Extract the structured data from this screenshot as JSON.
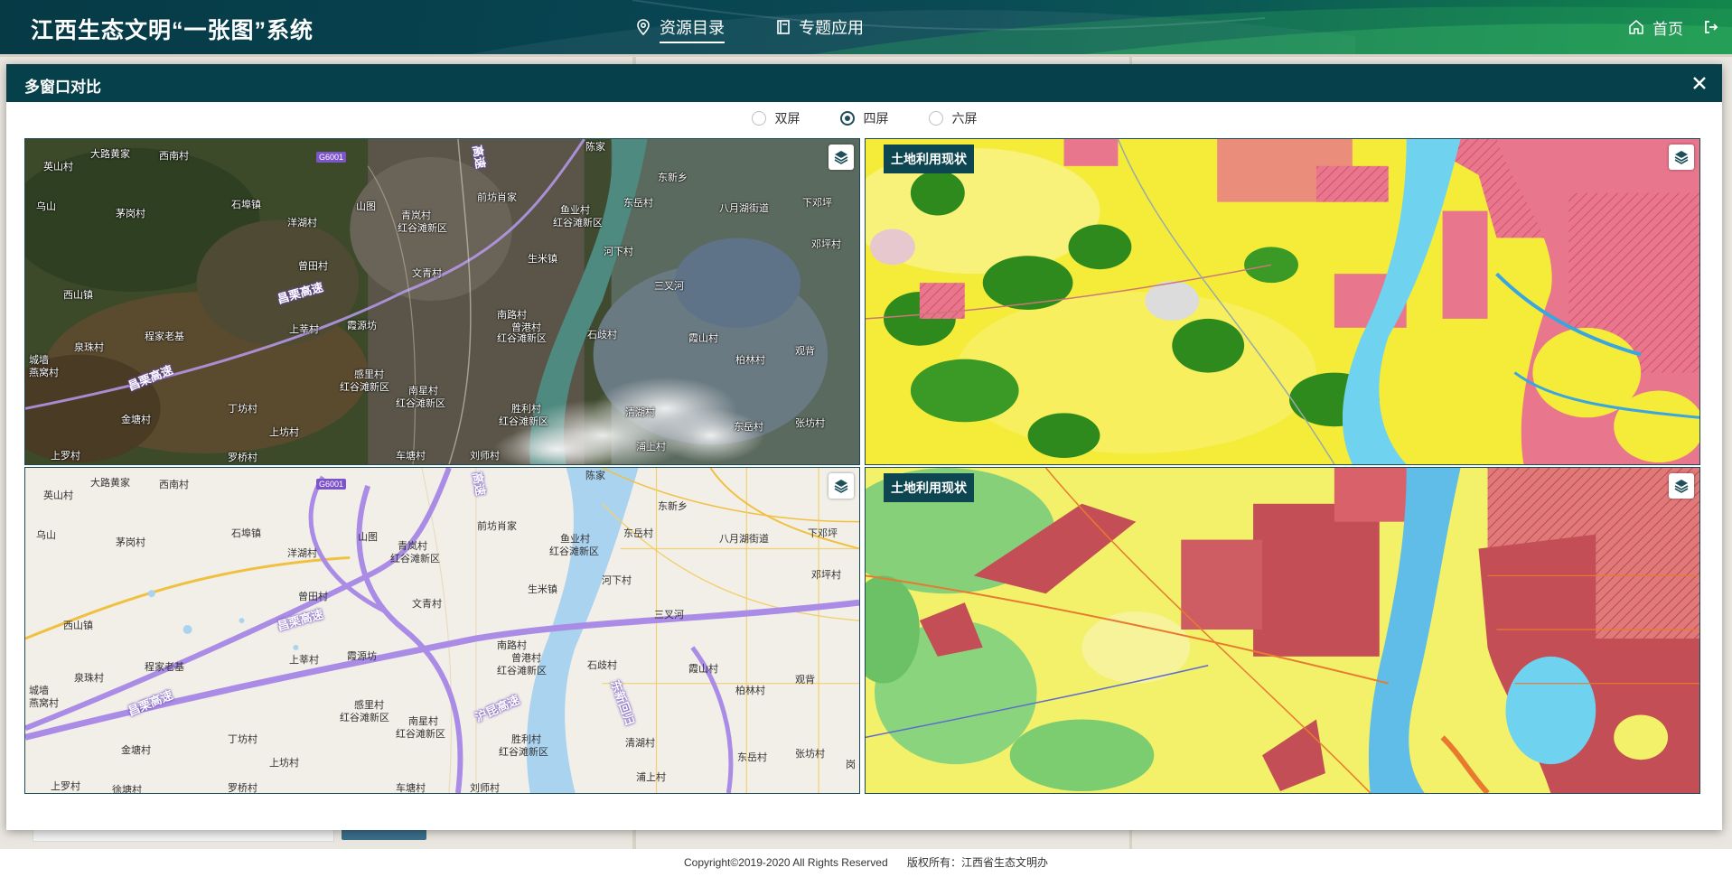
{
  "app": {
    "title": "江西生态文明“一张图”系统"
  },
  "nav": {
    "items": [
      {
        "label": "资源目录",
        "icon": "location-pin-icon",
        "active": true
      },
      {
        "label": "专题应用",
        "icon": "book-icon",
        "active": false
      }
    ],
    "home_label": "首页",
    "logout_icon": "logout-icon"
  },
  "modal": {
    "title": "多窗口对比",
    "close_icon": "close-icon",
    "layout_options": [
      {
        "label": "双屏",
        "checked": false
      },
      {
        "label": "四屏",
        "checked": true
      },
      {
        "label": "六屏",
        "checked": false
      }
    ],
    "panes": [
      {
        "type": "satellite",
        "label": "",
        "layer_icon": "layers-icon"
      },
      {
        "type": "land-use",
        "label": "土地利用现状",
        "layer_icon": "layers-icon"
      },
      {
        "type": "street",
        "label": "",
        "layer_icon": "layers-icon"
      },
      {
        "type": "land-use",
        "label": "土地利用现状",
        "layer_icon": "layers-icon"
      }
    ],
    "places": {
      "p01": "大路黄家",
      "p02": "西南村",
      "p03": "英山村",
      "p04": "东新乡",
      "p05": "前坊肖家",
      "p06": "鱼业村",
      "p07": "东岳村",
      "p08": "八月湖街道",
      "p09": "下邓坪",
      "p10": "乌山",
      "p11": "茅岗村",
      "p12": "石埠镇",
      "p13": "洋湖村",
      "p14": "山图",
      "p15": "青岚村",
      "p16": "红谷滩新区",
      "p17": "红谷滩新区",
      "p18": "河下村",
      "p19": "邓坪村",
      "p20": "曾田村",
      "p21": "文青村",
      "p22": "生米镇",
      "p23": "三叉河",
      "p24": "西山镇",
      "p25": "程家老基",
      "p26": "泉珠村",
      "p27": "上莘村",
      "p28": "霞源坊",
      "p29": "南路村",
      "p30": "曾港村",
      "p31": "红谷滩新区",
      "p32": "石歧村",
      "p33": "霞山村",
      "p34": "观背",
      "p35": "城墙",
      "p36": "燕窝村",
      "p37": "感里村",
      "p38": "红谷滩新区",
      "p39": "南星村",
      "p40": "红谷滩新区",
      "p41": "柏林村",
      "p42": "丁坊村",
      "p43": "胜利村",
      "p44": "红谷滩新区",
      "p45": "清湖村",
      "p46": "金塘村",
      "p47": "上坊村",
      "p48": "东岳村",
      "p49": "张坊村",
      "p50": "上罗村",
      "p51": "徐塘村",
      "p52": "罗桥村",
      "p53": "车塘村",
      "p54": "刘师村",
      "p55": "浦上村",
      "p56": "陈家",
      "p57": "岗",
      "shield": "G6001",
      "road1": "昌栗高速",
      "road2": "昌栗高速",
      "road3": "高速",
      "road4": "沪昆高速",
      "road5": "东新回归"
    }
  },
  "footer": {
    "copyright": "Copyright©2019-2020 All Rights Reserved",
    "owner": "版权所有：江西省生态文明办"
  }
}
